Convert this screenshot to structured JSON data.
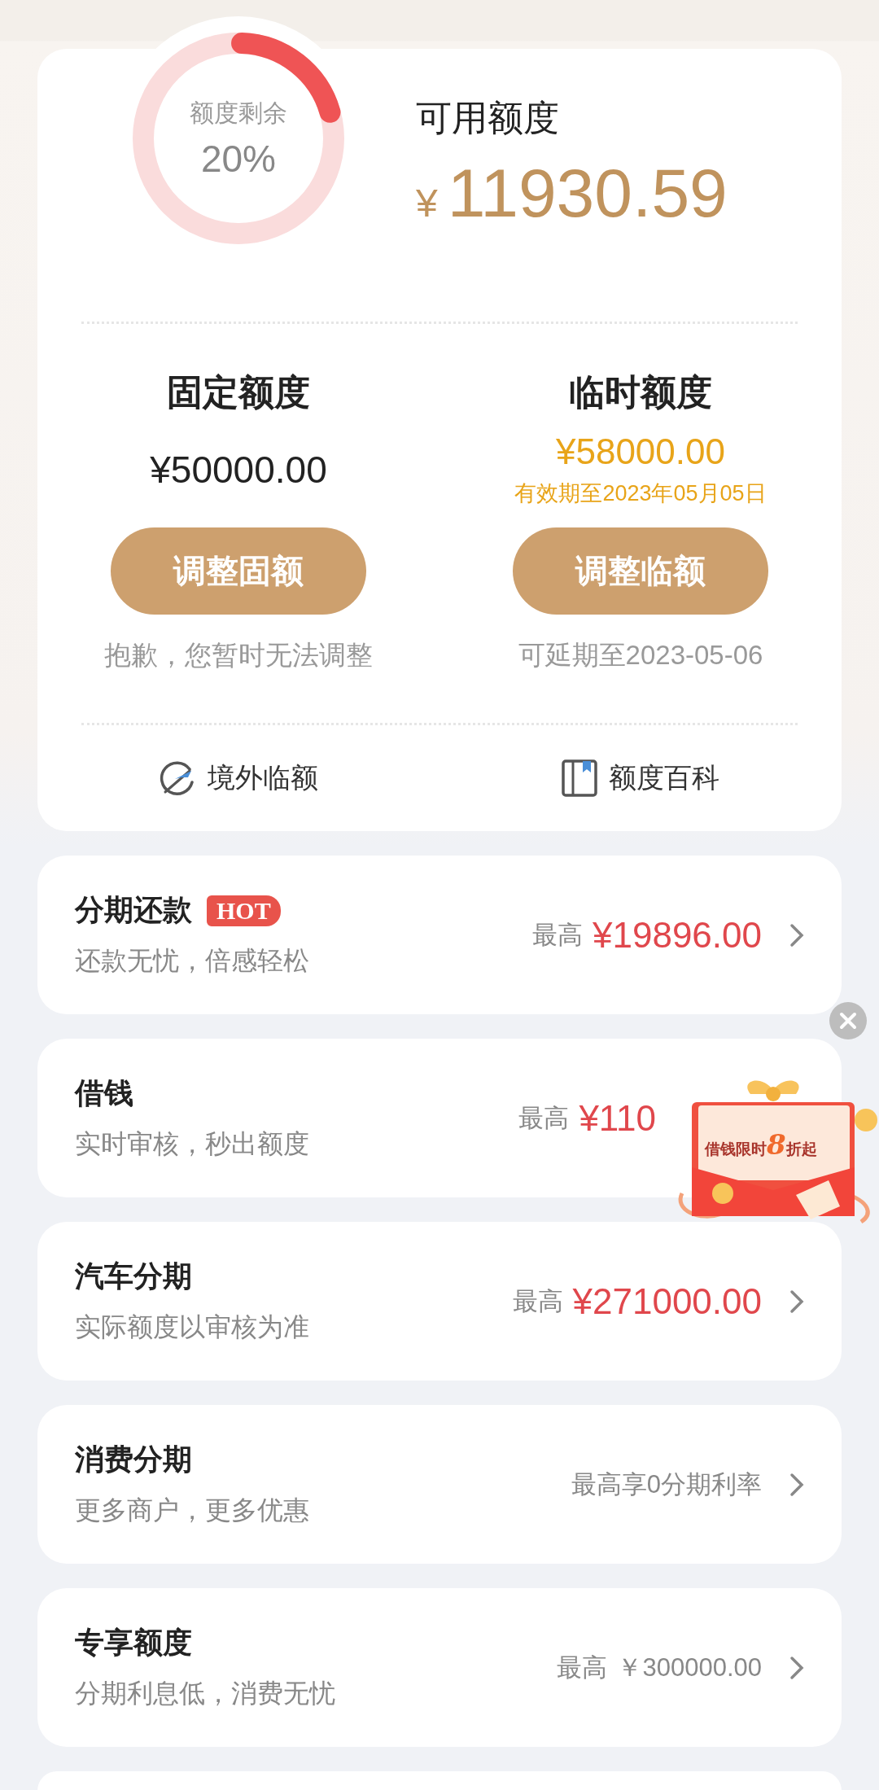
{
  "summary": {
    "ring": {
      "label": "额度剩余",
      "percent": "20%"
    },
    "available": {
      "label": "可用额度",
      "currency": "¥",
      "amount": "11930.59"
    },
    "columns": [
      {
        "title": "固定额度",
        "amount": "¥50000.00",
        "highlight": false,
        "button": "调整固额",
        "note": "抱歉，您暂时无法调整"
      },
      {
        "title": "临时额度",
        "amount": "¥58000.00",
        "highlight": true,
        "validity": "有效期至2023年05月05日",
        "button": "调整临额",
        "note": "可延期至2023-05-06"
      }
    ],
    "links": [
      {
        "kind": "globe",
        "label": "境外临额"
      },
      {
        "kind": "book",
        "label": "额度百科"
      }
    ]
  },
  "services": [
    {
      "title": "分期还款",
      "badge": "HOT",
      "subtitle": "还款无忧，倍感轻松",
      "prefix": "最高",
      "value": "¥19896.00",
      "highlight": true,
      "arrow": true
    },
    {
      "title": "借钱",
      "subtitle": "实时审核，秒出额度",
      "prefix": "最高",
      "value": "¥110",
      "highlight": true,
      "arrow": false
    },
    {
      "title": "汽车分期",
      "subtitle": "实际额度以审核为准",
      "prefix": "最高",
      "value": "¥271000.00",
      "highlight": true,
      "arrow": true
    },
    {
      "title": "消费分期",
      "subtitle": "更多商户，更多优惠",
      "value": "最高享0分期利率",
      "highlight": false,
      "arrow": true
    },
    {
      "title": "专享额度",
      "subtitle": "分期利息低，消费无忧",
      "prefix": "最高",
      "value": "￥300000.00",
      "highlight": false,
      "arrow": true
    }
  ],
  "promo": {
    "text": "借钱限时**8**折起"
  }
}
